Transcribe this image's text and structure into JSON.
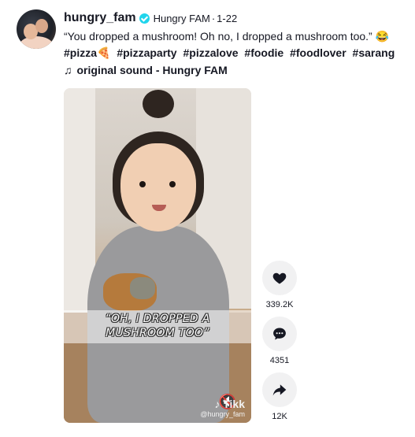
{
  "post": {
    "username": "hungry_fam",
    "nickname": "Hungry FAM",
    "separator": "·",
    "date": "1-22",
    "caption": "“You dropped a mushroom! Oh no, I dropped a mushroom too.”",
    "caption_emoji": "😂",
    "hashtags": [
      "#pizza🍕",
      "#pizzaparty",
      "#pizzalove",
      "#foodie",
      "#foodlover",
      "#sarang"
    ],
    "sound": "original sound - Hungry FAM"
  },
  "video": {
    "overlay_line1": "“OH, I DROPPED A",
    "overlay_line2": "MUSHROOM TOO”",
    "watermark_logo": "♪ Tik",
    "watermark_suffix": "k",
    "watermark_handle": "@hungry_fam"
  },
  "actions": {
    "likes": "339.2K",
    "comments": "4351",
    "shares": "12K"
  },
  "colors": {
    "verified": "#20d5ec",
    "action_bg": "#f1f1f2",
    "text": "#161823"
  }
}
